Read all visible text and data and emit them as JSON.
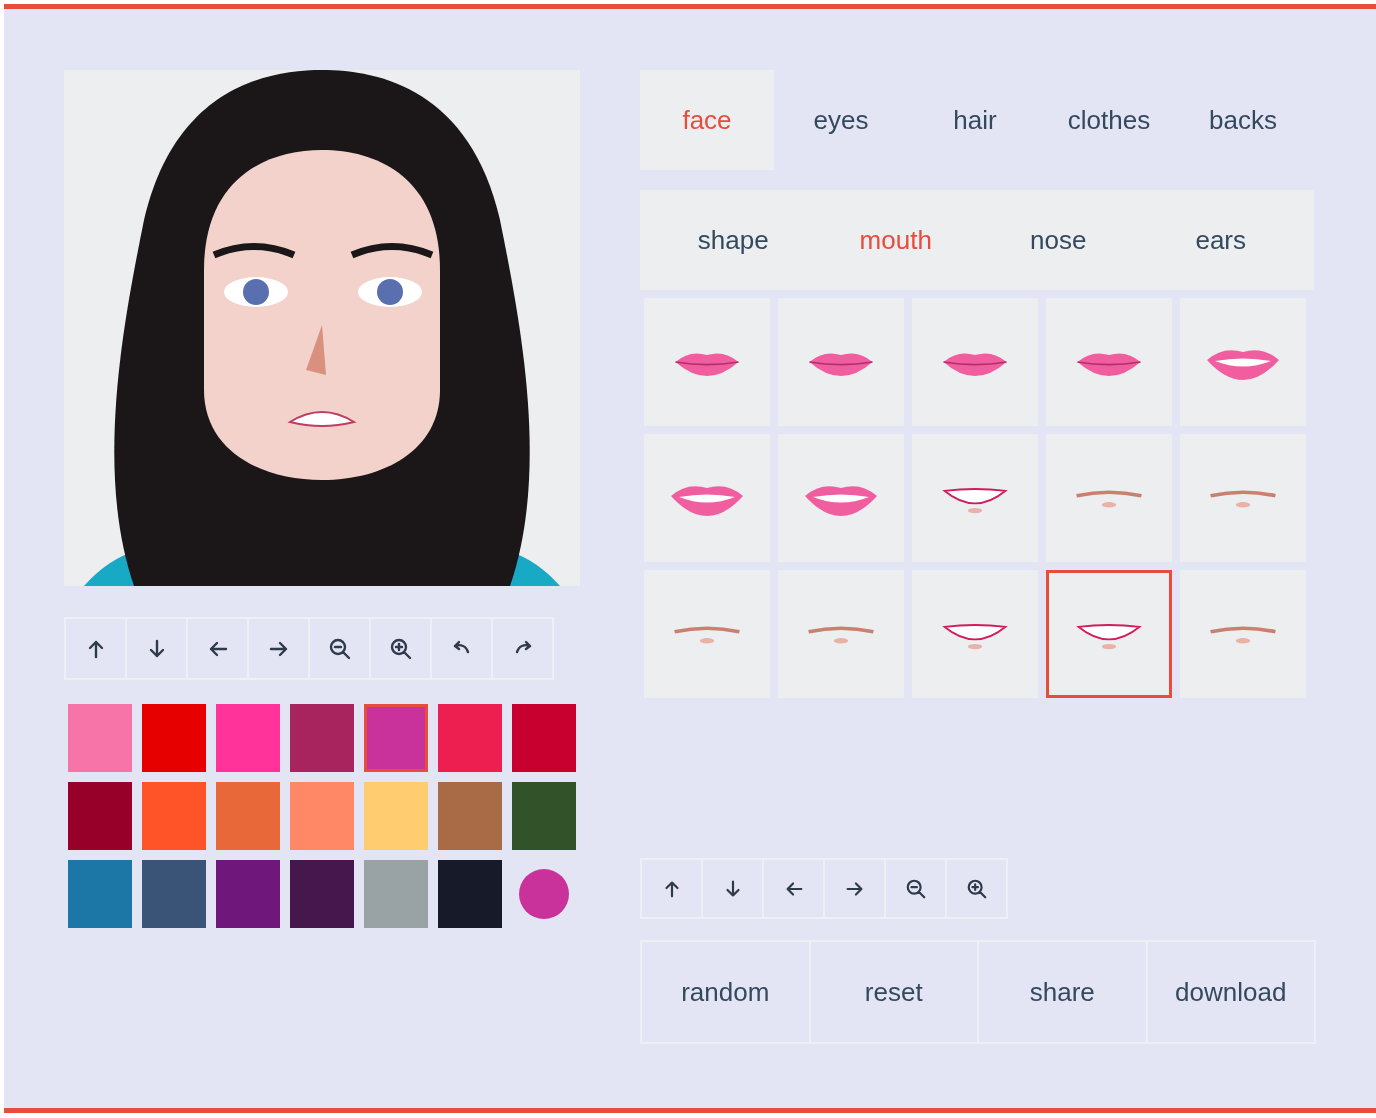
{
  "tabs": [
    {
      "label": "face",
      "selected": true
    },
    {
      "label": "eyes",
      "selected": false
    },
    {
      "label": "hair",
      "selected": false
    },
    {
      "label": "clothes",
      "selected": false
    },
    {
      "label": "backs",
      "selected": false
    }
  ],
  "subtabs": [
    {
      "label": "shape",
      "selected": false
    },
    {
      "label": "mouth",
      "selected": true
    },
    {
      "label": "nose",
      "selected": false
    },
    {
      "label": "ears",
      "selected": false
    }
  ],
  "options": [
    {
      "kind": "lips",
      "selected": false
    },
    {
      "kind": "lips",
      "selected": false
    },
    {
      "kind": "lips",
      "selected": false
    },
    {
      "kind": "lips",
      "selected": false
    },
    {
      "kind": "open-lips",
      "selected": false
    },
    {
      "kind": "open-lips",
      "selected": false
    },
    {
      "kind": "open-lips",
      "selected": false
    },
    {
      "kind": "smile",
      "selected": false
    },
    {
      "kind": "line",
      "selected": false
    },
    {
      "kind": "line",
      "selected": false
    },
    {
      "kind": "line",
      "selected": false
    },
    {
      "kind": "line",
      "selected": false
    },
    {
      "kind": "smile",
      "selected": false
    },
    {
      "kind": "smile",
      "selected": true
    },
    {
      "kind": "line",
      "selected": false
    }
  ],
  "swatches": [
    {
      "color": "#f774a8",
      "selected": false
    },
    {
      "color": "#e60000",
      "selected": false
    },
    {
      "color": "#ff3399",
      "selected": false
    },
    {
      "color": "#a8245e",
      "selected": false
    },
    {
      "color": "#c8329a",
      "selected": true
    },
    {
      "color": "#ec1f50",
      "selected": false
    },
    {
      "color": "#c80030",
      "selected": false
    },
    {
      "color": "#970028",
      "selected": false
    },
    {
      "color": "#ff5427",
      "selected": false
    },
    {
      "color": "#e8683a",
      "selected": false
    },
    {
      "color": "#ff8866",
      "selected": false
    },
    {
      "color": "#ffcc6f",
      "selected": false
    },
    {
      "color": "#a86b45",
      "selected": false
    },
    {
      "color": "#325229",
      "selected": false
    },
    {
      "color": "#1d77a6",
      "selected": false
    },
    {
      "color": "#3a5478",
      "selected": false
    },
    {
      "color": "#6f177b",
      "selected": false
    },
    {
      "color": "#46174d",
      "selected": false
    },
    {
      "color": "#99a2a4",
      "selected": false
    },
    {
      "color": "#171a28",
      "selected": false
    }
  ],
  "color_picker": {
    "color": "#c8329a"
  },
  "actions": [
    "random",
    "reset",
    "share",
    "download"
  ]
}
